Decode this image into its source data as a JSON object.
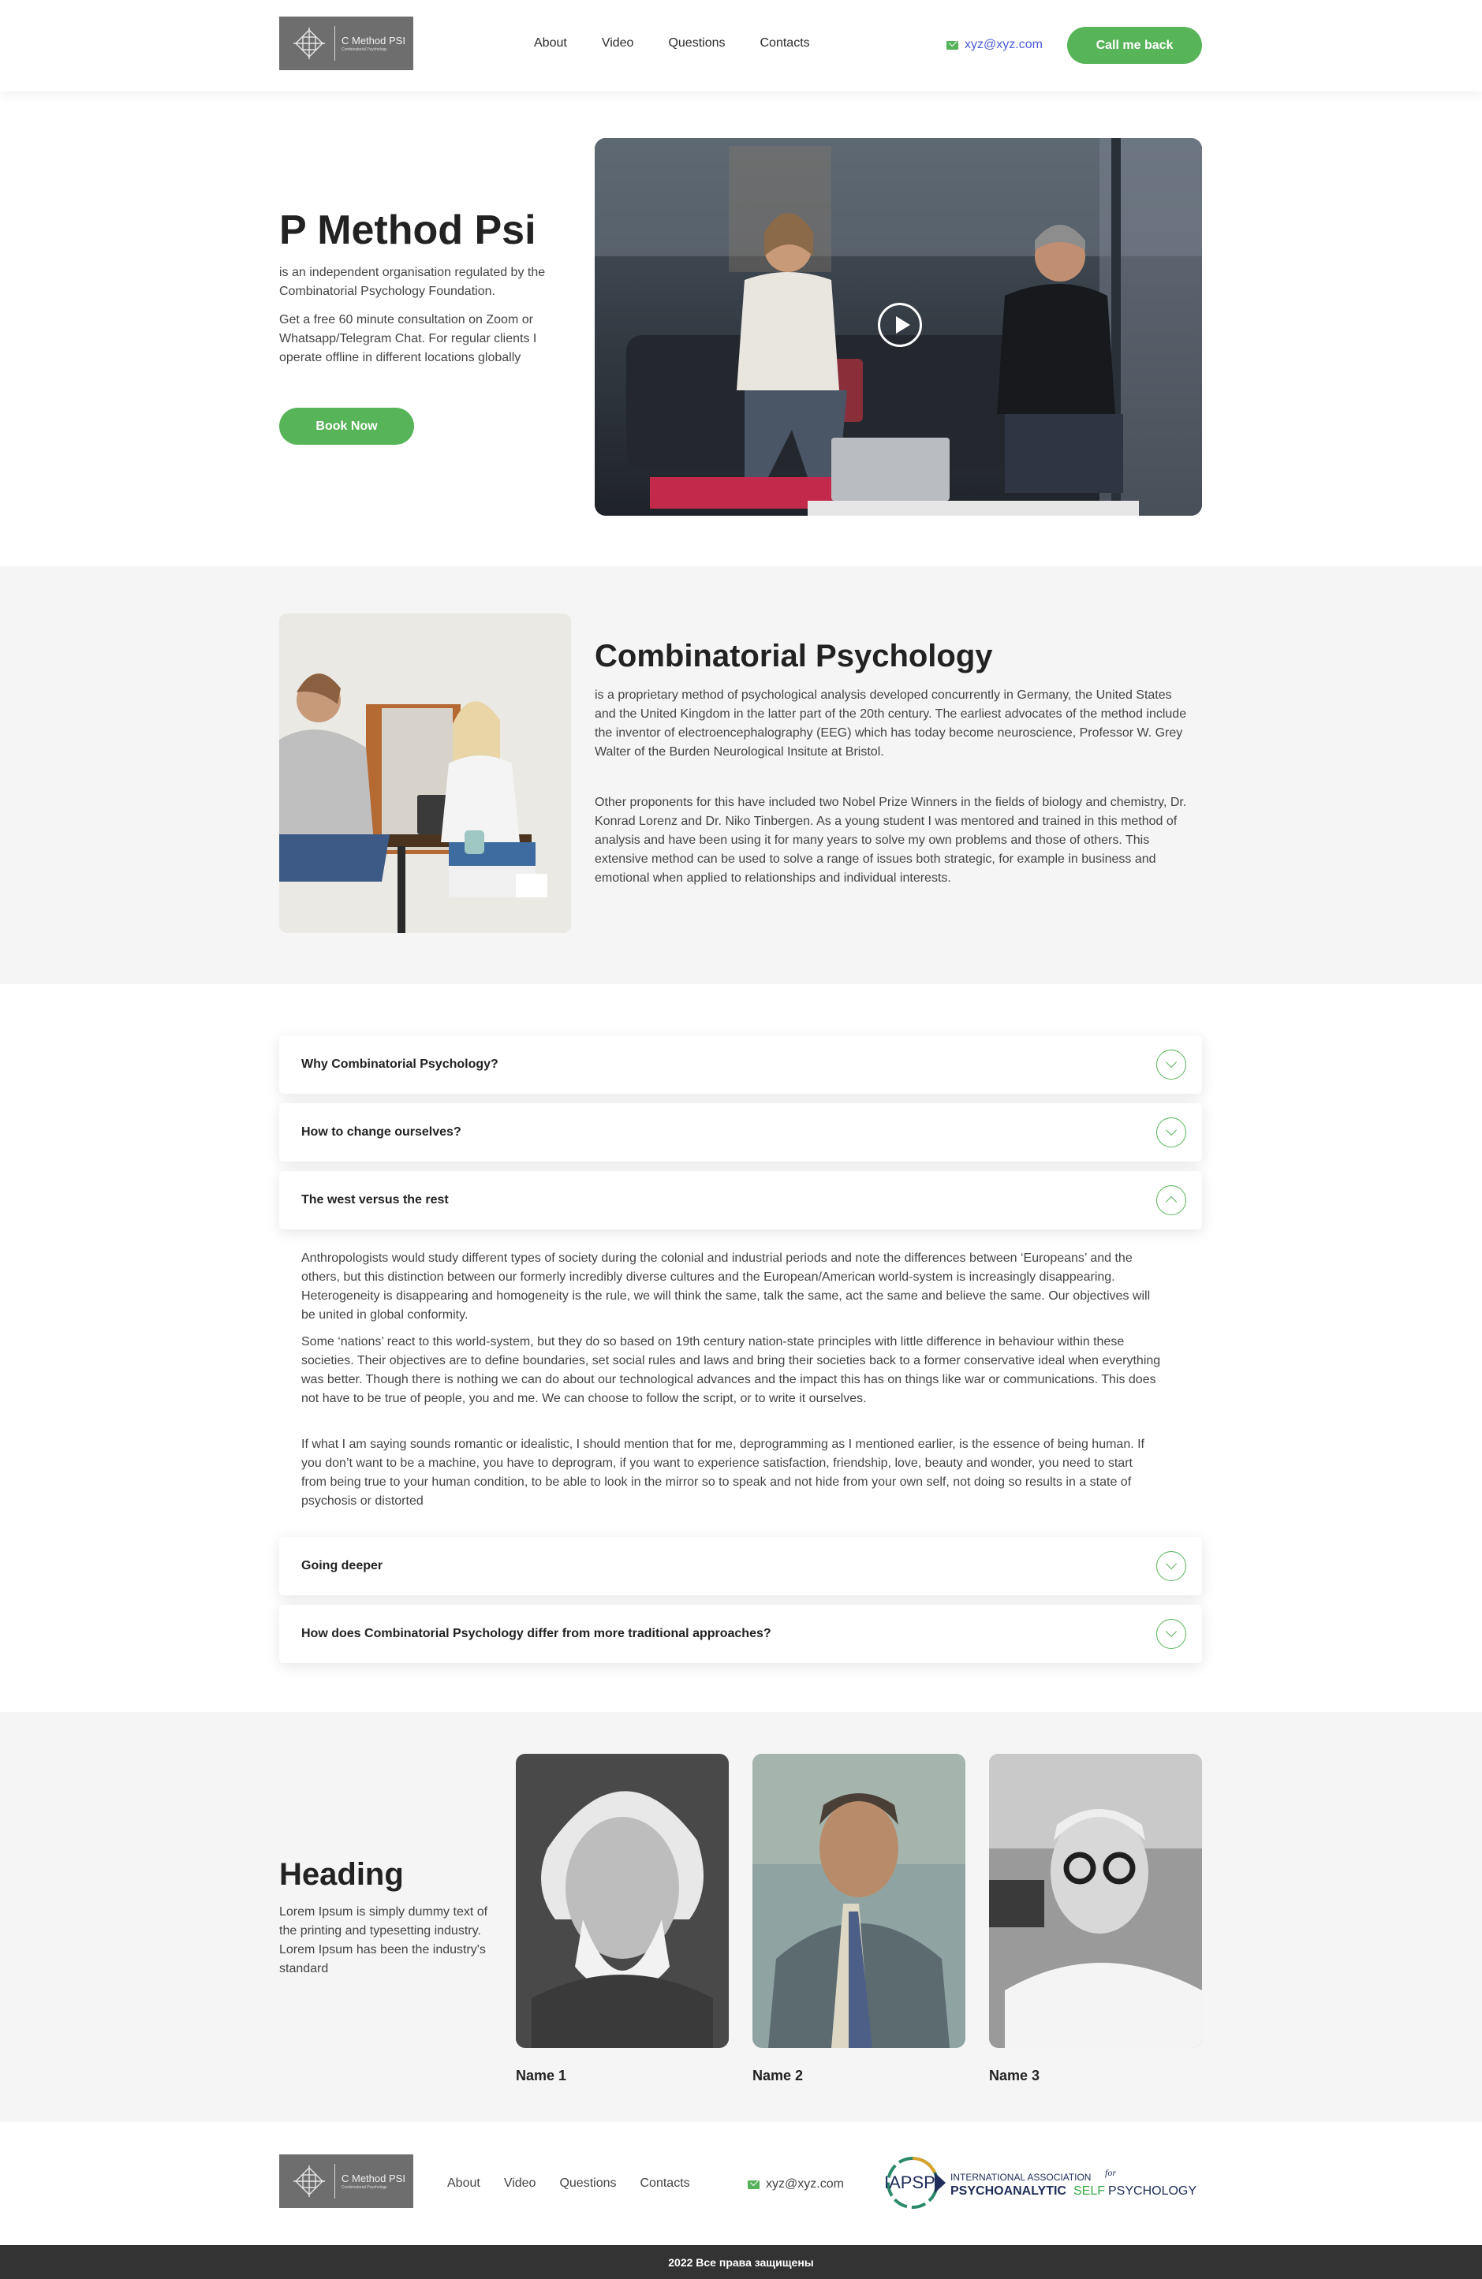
{
  "brand": {
    "logo_title": "C Method PSI",
    "logo_subtitle": "Combinatorial Psychology"
  },
  "nav": {
    "items": [
      "About",
      "Video",
      "Questions",
      "Contacts"
    ]
  },
  "header": {
    "email": "xyz@xyz.com",
    "cta_label": "Call me back"
  },
  "hero": {
    "title": "P Method Psi",
    "paragraph1": "is an independent organisation regulated by the Combinatorial Psychology Foundation.",
    "paragraph2": "Get a free 60 minute consultation on Zoom or Whatsapp/Telegram Chat. For regular clients I operate offline in different locations globally",
    "button_label": "Book Now"
  },
  "about": {
    "title": "Combinatorial Psychology",
    "paragraph1": "is a proprietary method of psychological analysis developed concurrently in Germany, the United States and the United Kingdom in the latter part of the 20th century. The earliest advocates of the method include the inventor of electroencephalography (EEG) which has today become neuroscience, Professor W. Grey Walter of the Burden Neurological Insitute at Bristol.",
    "paragraph2": "Other proponents for this have included two Nobel Prize Winners in the fields of biology and chemistry, Dr. Konrad Lorenz and Dr. Niko Tinbergen. As a young student I was mentored and trained in this method of analysis and have been using it for many years to solve my own problems and those of others. This extensive method can be used to solve a range of issues both strategic, for example in business and emotional when applied to relationships and individual interests."
  },
  "faq": {
    "items": [
      {
        "question": "Why Combinatorial Psychology?",
        "expanded": false
      },
      {
        "question": "How to change ourselves?",
        "expanded": false
      },
      {
        "question": "The west versus the rest",
        "expanded": true
      },
      {
        "question": "Going deeper",
        "expanded": false
      },
      {
        "question": "How does Combinatorial Psychology differ from more traditional approaches?",
        "expanded": false
      }
    ],
    "answer": {
      "paragraph1": "Anthropologists would study different types of society during the colonial and industrial periods and note the differences between ‘Europeans’ and the others, but this distinction between our formerly incredibly diverse cultures and the European/American world-system is increasingly disappearing. Heterogeneity is disappearing and homogeneity is the rule, we will think the same, talk the same, act the same and believe the same. Our objectives will be united in global conformity.",
      "paragraph2": "Some ‘nations’ react to this world-system, but they do so based on 19th century nation-state principles with little difference in behaviour within these societies. Their objectives are to define boundaries, set social rules and laws and bring their societies back to a former conservative ideal when everything was better. Though there is nothing we can do about our technological advances and the impact this has on things like war or communications. This does not have to be true of people, you and me. We can choose to follow the script, or to write it ourselves.",
      "paragraph3": "If what I am saying sounds romantic or idealistic, I should mention that for me, deprogramming as I mentioned earlier, is the essence of being human. If you don’t want to be a machine, you have to deprogram, if you want to experience satisfaction, friendship, love, beauty and wonder, you need to start from being true to your human condition, to be able to look in the mirror so to speak and not hide from your own self, not doing so results in a state of psychosis or distorted"
    }
  },
  "team": {
    "heading": "Heading",
    "text": "Lorem Ipsum is simply dummy text of the printing and typesetting industry. Lorem Ipsum has been the industry's standard",
    "members": [
      {
        "name": "Name 1"
      },
      {
        "name": "Name 2"
      },
      {
        "name": "Name 3"
      }
    ]
  },
  "footer": {
    "nav": [
      "About",
      "Video",
      "Questions",
      "Contacts"
    ],
    "email": "xyz@xyz.com",
    "partner": {
      "abbr": "IAPSP",
      "line1": "INTERNATIONAL ASSOCIATION",
      "for": "for",
      "line2a": "PSYCHOANALYTIC",
      "line2b": "SELF",
      "line2c": "PSYCHOLOGY"
    },
    "copyright": "2022 Все права защищены"
  },
  "colors": {
    "accent": "#57b459",
    "link": "#4a5bd6",
    "section_bg": "#f5f5f5",
    "footer_bar": "#333333"
  }
}
